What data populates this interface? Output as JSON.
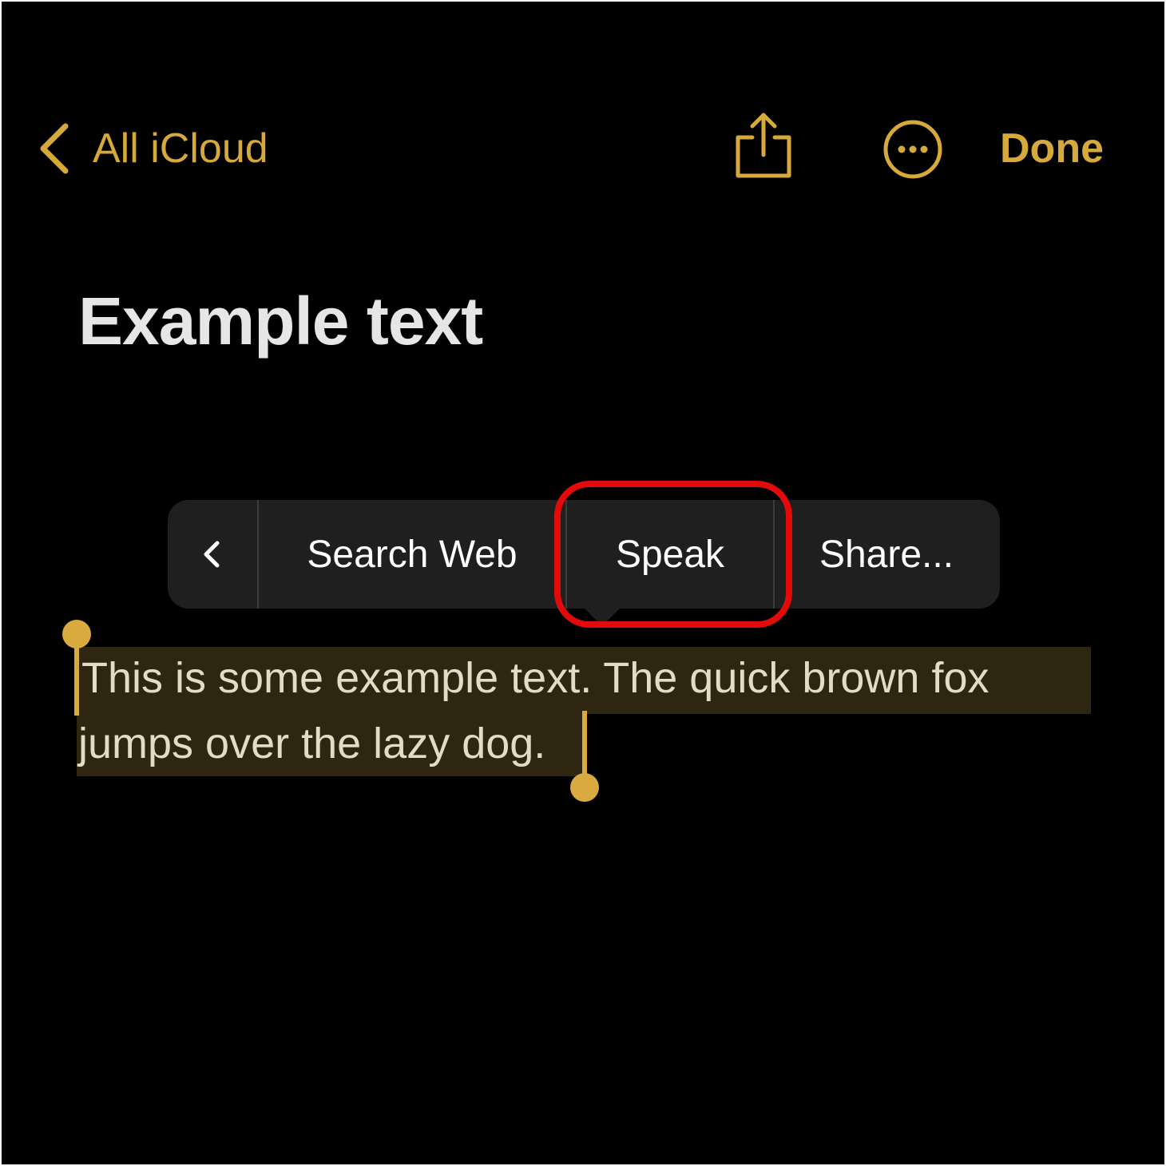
{
  "nav": {
    "back_label": "All iCloud",
    "back_icon": "chevron-left-icon",
    "share_icon": "share-icon",
    "more_icon": "ellipsis-circle-icon",
    "done_label": "Done",
    "accent_color": "#d6a93b"
  },
  "note": {
    "title": "Example text",
    "body_line_1": "This is some example text.  The quick brown fox",
    "body_line_2": "jumps over the lazy dog."
  },
  "edit_menu": {
    "back_icon": "chevron-left-icon",
    "items": [
      {
        "label": "Search Web"
      },
      {
        "label": "Speak"
      },
      {
        "label": "Share..."
      }
    ],
    "highlighted_item": "Speak",
    "highlight_color": "#e30a0a"
  },
  "selection": {
    "highlight_color": "#2e2611",
    "handle_color": "#d8aa3f"
  }
}
